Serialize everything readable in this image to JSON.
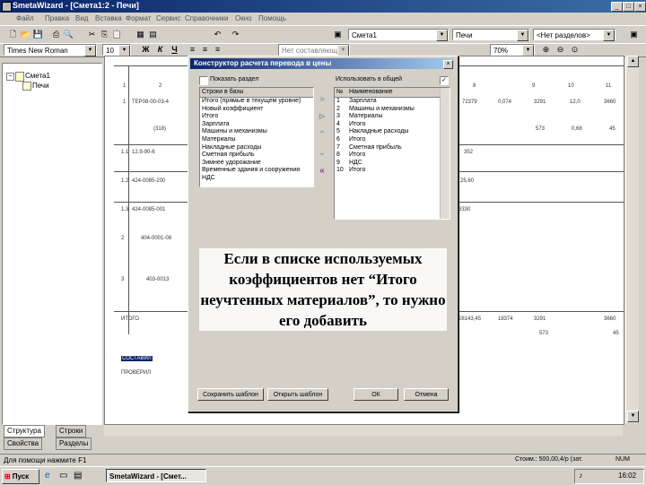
{
  "window": {
    "title": "SmetaWizard - [Смета1:2 - Печи]"
  },
  "menu": [
    "Файл",
    "Правка",
    "Вид",
    "Вставка",
    "Формат",
    "Сервис",
    "Справочники",
    "Окно",
    "Помощь"
  ],
  "toolbar_top": {
    "estimate_combo": "Смета1",
    "section_combo": "Печи",
    "subsection_combo": "<Нет разделов>"
  },
  "toolbar_format": {
    "font": "Times New Roman",
    "size": "10",
    "bold": "Ж",
    "italic": "К",
    "underline": "Ч",
    "style_combo": "Нет составляющей",
    "zoom": "70%"
  },
  "tree": {
    "root": "Смета1",
    "child": "Печи"
  },
  "left_tabs": [
    "Структура",
    "Строки",
    "Свойства",
    "Разделы"
  ],
  "document": {
    "header_nums": [
      "1",
      "2",
      "3",
      "4",
      "5",
      "6",
      "7",
      "8",
      "9",
      "10",
      "11"
    ],
    "rows": [
      {
        "c1": "1",
        "c2": "ТЕР08-00-03-4",
        "c3": "72379",
        "c4": "0,074",
        "c5": "3291",
        "c6": "12,0",
        "c7": "3660"
      },
      {
        "c1": "",
        "c2": "(318)",
        "c3": "",
        "c4": "",
        "c5": "573",
        "c6": "0,68",
        "c7": "45"
      },
      {
        "c1": "1.1",
        "c2": "12.9-90-6",
        "c3": "",
        "c4": "352",
        "c5": "",
        "c6": "",
        "c7": ""
      },
      {
        "c1": "1.2",
        "c2": "424-0085-200",
        "c3": "",
        "c4": "25,60",
        "c5": "",
        "c6": "",
        "c7": ""
      },
      {
        "c1": "1.3",
        "c2": "424-0085-001",
        "c3": "",
        "c4": "3330",
        "c5": "",
        "c6": "",
        "c7": ""
      },
      {
        "c1": "2",
        "c2": "404-0001-08",
        "c3": "",
        "c4": "",
        "c5": "",
        "c6": "",
        "c7": ""
      },
      {
        "c1": "3",
        "c2": "403-0013",
        "c3": "",
        "c4": "",
        "c5": "",
        "c6": "",
        "c7": ""
      }
    ],
    "total_label": "ИТОГО",
    "total_values": [
      "28143,45",
      "18374",
      "3291",
      "3660"
    ],
    "total_sub": [
      "573",
      "45"
    ],
    "footer1": "СОСТАВИЛ",
    "footer2": "ПРОВЕРИЛ"
  },
  "dialog": {
    "title": "Конструктор расчета перевода в цены",
    "check_left": "Показать раздел",
    "check_right": "Использовать в общей",
    "left_header": "Строки в базы",
    "left_items": [
      "Итого (прямые в текущем уровне)",
      "Новый коэффициент",
      "Итого",
      "Зарплата",
      "Машины и механизмы",
      "Материалы",
      "Накладные расходы",
      "Сметная прибыль",
      "Зимнее удорожание",
      "Временные здания и сооружения",
      "НДС"
    ],
    "right_header_num": "№",
    "right_header_name": "Наименование",
    "right_items": [
      {
        "n": "1",
        "name": "Зарплата"
      },
      {
        "n": "2",
        "name": "Машины и механизмы"
      },
      {
        "n": "3",
        "name": "Материалы"
      },
      {
        "n": "4",
        "name": "Итого"
      },
      {
        "n": "5",
        "name": "Накладные расходы"
      },
      {
        "n": "6",
        "name": "Итого"
      },
      {
        "n": "7",
        "name": "Сметная прибыль"
      },
      {
        "n": "8",
        "name": "Итого"
      },
      {
        "n": "9",
        "name": "НДС"
      },
      {
        "n": "10",
        "name": "Итого"
      }
    ],
    "buttons": {
      "save": "Сохранить шаблон",
      "open": "Открыть шаблон",
      "ok": "ОК",
      "cancel": "Отмена"
    },
    "note": "Если в списке используемых коэффициентов нет “Итого неучтенных материалов”, то нужно его добавить"
  },
  "status": {
    "help": "Для помощи нажмите F1",
    "cost": "Стоим.: 500,00,4/р (зат.",
    "num": "NUM"
  },
  "taskbar": {
    "start": "Пуск",
    "task": "SmetaWizard - [Смет...",
    "clock": "16:02"
  }
}
